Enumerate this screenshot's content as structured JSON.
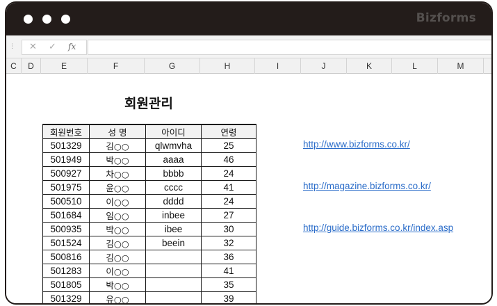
{
  "window": {
    "brand": "Bizforms"
  },
  "formula_bar": {
    "cancel_glyph": "✕",
    "enter_glyph": "✓",
    "fx_label": "fx",
    "value": ""
  },
  "columns": [
    "C",
    "D",
    "E",
    "F",
    "G",
    "H",
    "I",
    "J",
    "K",
    "L",
    "M"
  ],
  "sheet": {
    "title": "회원관리",
    "table": {
      "headers": [
        "회원번호",
        "성  명",
        "아이디",
        "연령"
      ],
      "rows": [
        [
          "501329",
          "김○○",
          "qlwmvha",
          "25"
        ],
        [
          "501949",
          "박○○",
          "aaaa",
          "46"
        ],
        [
          "500927",
          "차○○",
          "bbbb",
          "24"
        ],
        [
          "501975",
          "윤○○",
          "cccc",
          "41"
        ],
        [
          "500510",
          "이○○",
          "dddd",
          "24"
        ],
        [
          "501684",
          "임○○",
          "inbee",
          "27"
        ],
        [
          "500935",
          "박○○",
          "ibee",
          "30"
        ],
        [
          "501524",
          "김○○",
          "beein",
          "32"
        ],
        [
          "500816",
          "김○○",
          "",
          "36"
        ],
        [
          "501283",
          "이○○",
          "",
          "41"
        ],
        [
          "501805",
          "박○○",
          "",
          "35"
        ],
        [
          "501329",
          "유○○",
          "",
          "39"
        ]
      ]
    },
    "links": [
      "http://www.bizforms.co.kr/",
      "http://magazine.bizforms.co.kr/",
      "http://guide.bizforms.co.kr/index.asp"
    ]
  }
}
